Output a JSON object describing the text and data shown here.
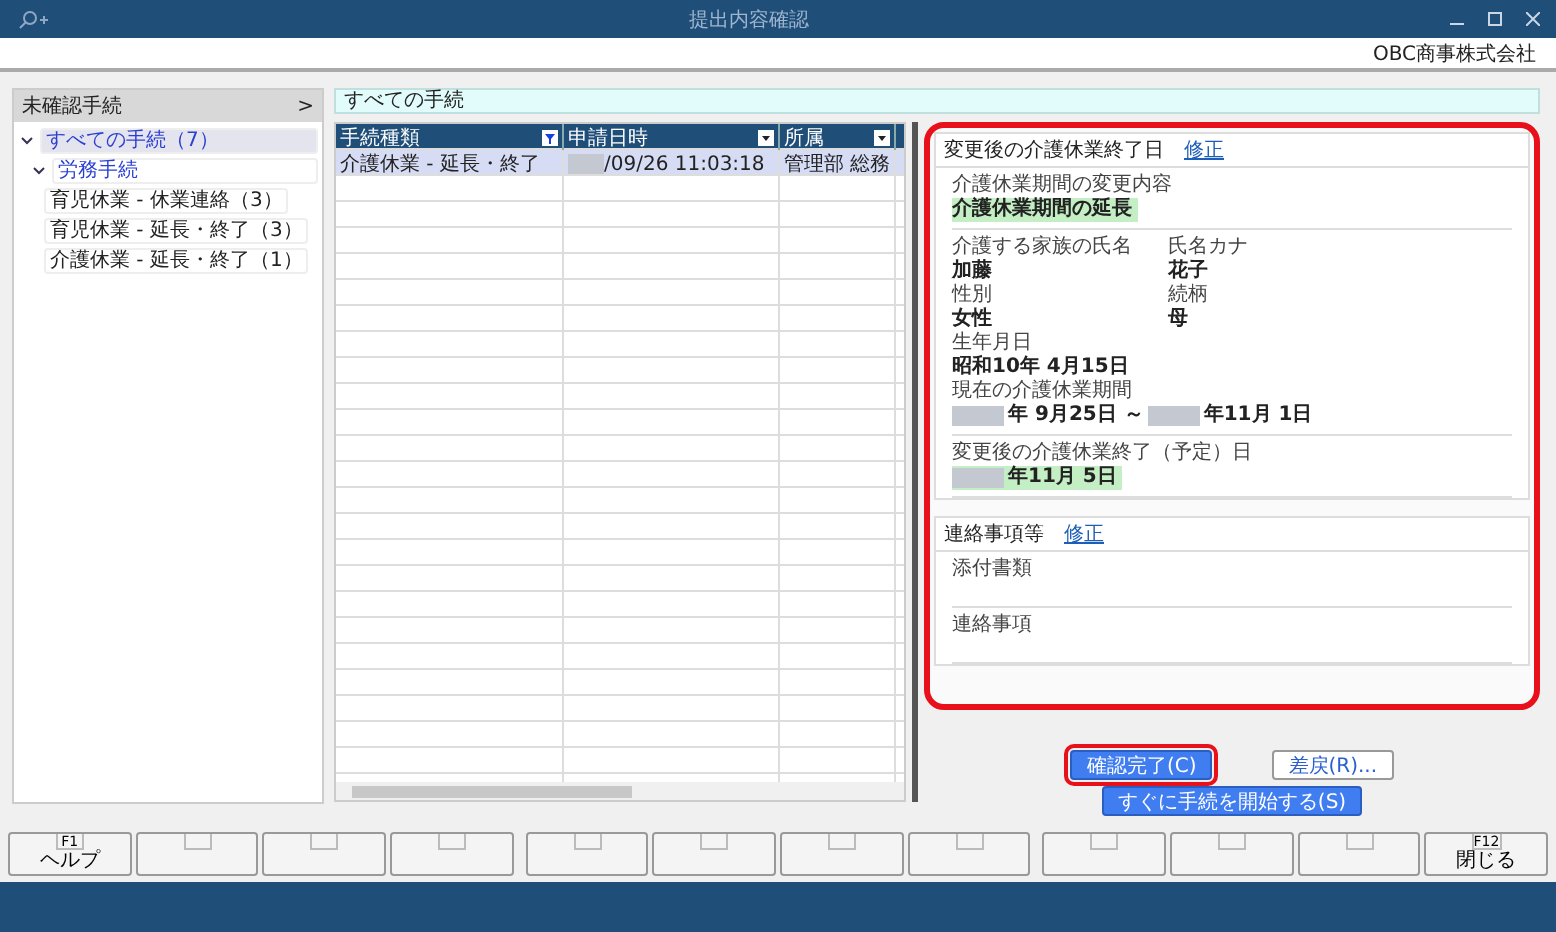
{
  "window": {
    "title": "提出内容確認",
    "company": "OBC商事株式会社"
  },
  "sidebar": {
    "title": "未確認手続",
    "toggle": ">",
    "tree": [
      {
        "label": "すべての手続（7）",
        "expanded": true,
        "selected": true,
        "children": [
          {
            "label": "労務手続",
            "expanded": true,
            "selected": false,
            "children": [
              {
                "label": "育児休業 - 休業連絡（3）",
                "selected": false
              },
              {
                "label": "育児休業 - 延長・終了（3）",
                "selected": false
              },
              {
                "label": "介護休業 - 延長・終了（1）",
                "selected": false
              }
            ]
          }
        ]
      }
    ]
  },
  "filter_banner": "すべての手続",
  "table": {
    "columns": [
      {
        "label": "手続種類",
        "filtered": true
      },
      {
        "label": "申請日時",
        "filtered": false
      },
      {
        "label": "所属",
        "filtered": false
      }
    ],
    "rows": [
      {
        "selected": true,
        "cells": [
          {
            "text": "介護休業 - 延長・終了"
          },
          {
            "text": "/09/26 11:03:18",
            "redacted_prefix": true
          },
          {
            "text": "管理部 総務"
          }
        ]
      }
    ]
  },
  "detail": {
    "highlighted": true,
    "sections": [
      {
        "title": "変更後の介護休業終了日",
        "edit_link": "修正",
        "groups": [
          {
            "fields": [
              {
                "label": "介護休業期間の変更内容",
                "value": [
                  {
                    "text": "介護休業期間の延長"
                  }
                ],
                "changed": true
              }
            ]
          },
          {
            "fields": [
              {
                "label": "介護する家族の氏名",
                "value": [
                  {
                    "text": "加藤"
                  }
                ],
                "changed": false,
                "pair": {
                  "label": "氏名カナ",
                  "value": "花子"
                }
              },
              {
                "label": "性別",
                "value": [
                  {
                    "text": "女性"
                  }
                ],
                "changed": false,
                "pair": {
                  "label": "続柄",
                  "value": "母"
                }
              },
              {
                "label": "生年月日",
                "value": [
                  {
                    "text": "昭和10年 4月15日"
                  }
                ],
                "changed": false
              },
              {
                "label": "現在の介護休業期間",
                "value": [
                  {
                    "text": "年 9月25日 ～",
                    "redacted_prefix": true
                  },
                  {
                    "text": "年11月 1日",
                    "redacted_prefix": true
                  }
                ],
                "changed": false
              }
            ]
          },
          {
            "fields": [
              {
                "label": "変更後の介護休業終了（予定）日",
                "value": [
                  {
                    "text": "年11月  5日",
                    "redacted_prefix": true
                  }
                ],
                "changed": true
              }
            ]
          }
        ]
      },
      {
        "title": "連絡事項等",
        "edit_link": "修正",
        "groups": [
          {
            "fields": [
              {
                "label": "添付書類"
              }
            ]
          },
          {
            "fields": [
              {
                "label": "連絡事項"
              }
            ]
          }
        ]
      }
    ]
  },
  "actions": [
    {
      "label": "確認完了(C)",
      "kind": "primary",
      "highlighted": true
    },
    {
      "label": "差戻(R)...",
      "kind": "secondary",
      "highlighted": false
    },
    {
      "label": "すぐに手続を開始する(S)",
      "kind": "primary",
      "highlighted": false
    }
  ],
  "function_keys": [
    {
      "kind": "labeled",
      "key": "F1",
      "label": "ヘルプ"
    },
    {
      "kind": "blank"
    },
    {
      "kind": "blank"
    },
    {
      "kind": "blank"
    },
    {
      "kind": "blank"
    },
    {
      "kind": "blank"
    },
    {
      "kind": "blank"
    },
    {
      "kind": "blank"
    },
    {
      "kind": "blank"
    },
    {
      "kind": "blank"
    },
    {
      "kind": "blank"
    },
    {
      "kind": "labeled",
      "key": "F12",
      "label": "閉じる"
    }
  ]
}
